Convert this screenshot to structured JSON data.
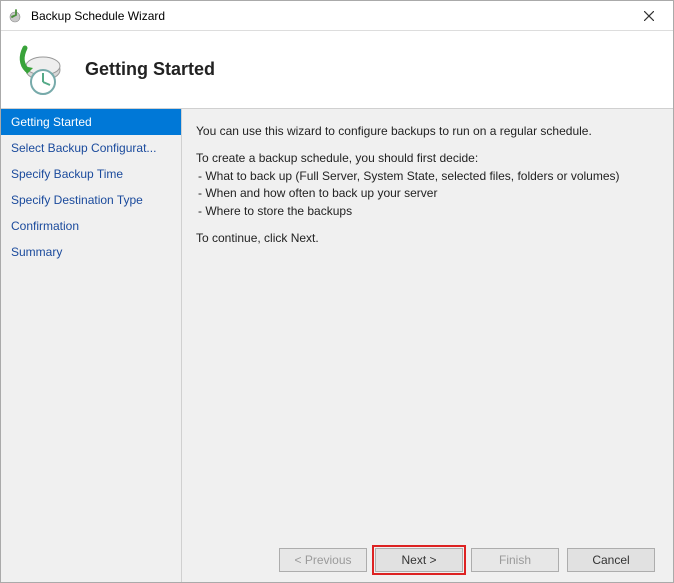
{
  "titlebar": {
    "title": "Backup Schedule Wizard"
  },
  "header": {
    "title": "Getting Started"
  },
  "sidebar": {
    "items": [
      {
        "label": "Getting Started",
        "active": true
      },
      {
        "label": "Select Backup Configurat...",
        "active": false
      },
      {
        "label": "Specify Backup Time",
        "active": false
      },
      {
        "label": "Specify Destination Type",
        "active": false
      },
      {
        "label": "Confirmation",
        "active": false
      },
      {
        "label": "Summary",
        "active": false
      }
    ]
  },
  "content": {
    "intro": "You can use this wizard to configure backups to run on a regular schedule.",
    "decide_intro": "To create a backup schedule, you should first decide:",
    "bullets": [
      "-   What to back up (Full Server, System State, selected files, folders or volumes)",
      "-   When and how often to back up your server",
      "-   Where to store the backups"
    ],
    "continue": "To continue, click Next."
  },
  "footer": {
    "previous": "< Previous",
    "next": "Next >",
    "finish": "Finish",
    "cancel": "Cancel"
  }
}
